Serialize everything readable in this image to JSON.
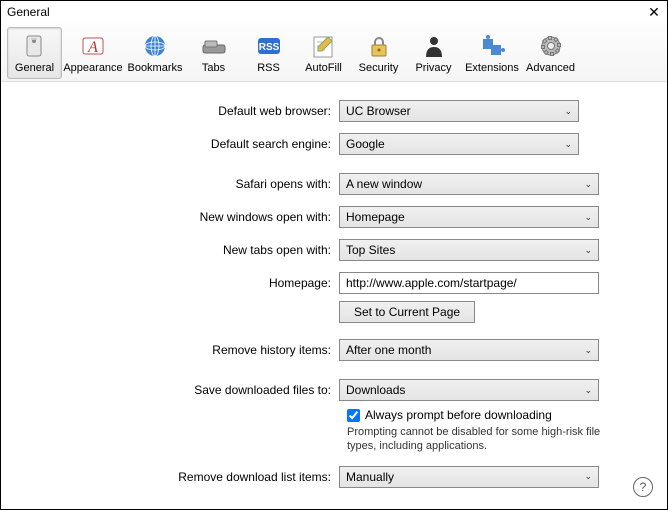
{
  "window": {
    "title": "General"
  },
  "toolbar": [
    {
      "name": "general",
      "label": "General",
      "active": true
    },
    {
      "name": "appearance",
      "label": "Appearance",
      "active": false,
      "wide": true
    },
    {
      "name": "bookmarks",
      "label": "Bookmarks",
      "active": false,
      "wide": true
    },
    {
      "name": "tabs",
      "label": "Tabs",
      "active": false
    },
    {
      "name": "rss",
      "label": "RSS",
      "active": false
    },
    {
      "name": "autofill",
      "label": "AutoFill",
      "active": false
    },
    {
      "name": "security",
      "label": "Security",
      "active": false
    },
    {
      "name": "privacy",
      "label": "Privacy",
      "active": false
    },
    {
      "name": "extensions",
      "label": "Extensions",
      "active": false,
      "wide": true
    },
    {
      "name": "advanced",
      "label": "Advanced",
      "active": false
    }
  ],
  "labels": {
    "default_browser": "Default web browser:",
    "default_search": "Default search engine:",
    "safari_opens": "Safari opens with:",
    "new_windows": "New windows open with:",
    "new_tabs": "New tabs open with:",
    "homepage": "Homepage:",
    "set_current": "Set to Current Page",
    "remove_history": "Remove history items:",
    "save_downloads": "Save downloaded files to:",
    "always_prompt": "Always prompt before downloading",
    "prompt_note": "Prompting cannot be disabled for some high-risk file types, including applications.",
    "remove_downloads": "Remove download list items:"
  },
  "values": {
    "default_browser": "UC Browser",
    "default_search": "Google",
    "safari_opens": "A new window",
    "new_windows": "Homepage",
    "new_tabs": "Top Sites",
    "homepage": "http://www.apple.com/startpage/",
    "remove_history": "After one month",
    "save_downloads": "Downloads",
    "always_prompt": true,
    "remove_downloads": "Manually"
  }
}
